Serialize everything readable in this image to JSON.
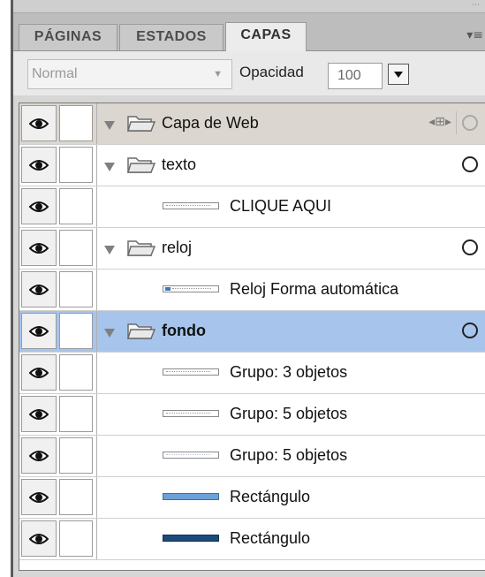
{
  "tabs": [
    {
      "label": "PÁGINAS",
      "active": false
    },
    {
      "label": "ESTADOS",
      "active": false
    },
    {
      "label": "CAPAS",
      "active": true
    }
  ],
  "panel_menu_icon": "panel-menu-icon",
  "toolbar": {
    "blend_mode": "Normal",
    "opacity_label": "Opacidad",
    "opacity_value": "100"
  },
  "layers": {
    "web_layer": {
      "name": "Capa de Web"
    },
    "texto": {
      "name": "texto",
      "objects": [
        "CLIQUE AQUI"
      ]
    },
    "reloj": {
      "name": "reloj",
      "objects": [
        "Reloj Forma automática"
      ]
    },
    "fondo": {
      "name": "fondo",
      "objects": [
        "Grupo: 3 objetos",
        "Grupo: 5 objetos",
        "Grupo: 5 objetos",
        "Rectángulo",
        "Rectángulo"
      ]
    }
  },
  "colors": {
    "selected_row": "#a7c5ec",
    "web_layer_row": "#dbd6cf",
    "rect_light_blue": "#6aa1d8",
    "rect_dark_blue": "#1d4a7a"
  }
}
